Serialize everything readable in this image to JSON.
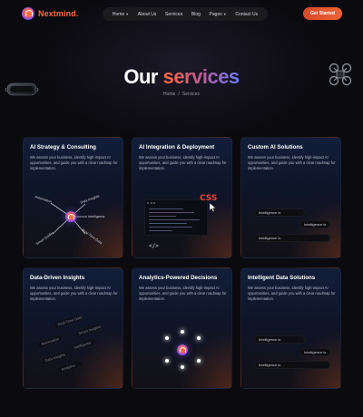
{
  "brand": {
    "name": "Nextmind",
    "dot": "."
  },
  "nav": {
    "items": [
      {
        "label": "Home",
        "dropdown": true
      },
      {
        "label": "About Us",
        "dropdown": false
      },
      {
        "label": "Services",
        "dropdown": false
      },
      {
        "label": "Blog",
        "dropdown": false
      },
      {
        "label": "Pages",
        "dropdown": true
      },
      {
        "label": "Contact Us",
        "dropdown": false
      }
    ],
    "cta_label": "Get Started"
  },
  "hero": {
    "title_part1": "Our",
    "title_part2": "services",
    "breadcrumb": {
      "home": "Home",
      "separator": "/",
      "current": "Services"
    }
  },
  "cards": [
    {
      "title": "AI Strategy & Consulting",
      "description": "We assess your business, identify high-impact AI opportunities, and guide you with a clear roadmap for implementation.",
      "art_labels": [
        "Automation",
        "Data Insights",
        "Intelligenta",
        "Smart Guides",
        "Real-Time Data"
      ]
    },
    {
      "title": "AI Integration & Deployment",
      "description": "We assess your business, identify high-impact AI opportunities, and guide you with a clear roadmap for implementation.",
      "art_labels": [
        "CSS",
        "</>"
      ]
    },
    {
      "title": "Custom AI Solutions",
      "description": "We assess your business, identify high-impact AI opportunities, and guide you with a clear roadmap for implementation.",
      "art_labels": [
        "Intelligence is",
        "Intelligence is",
        "Intelligence is"
      ]
    },
    {
      "title": "Data-Driven Insights",
      "description": "We assess your business, identify high-impact AI opportunities, and guide you with a clear roadmap for implementation.",
      "art_labels": [
        "Real-Time Data",
        "Smart Insights",
        "Automation",
        "Intelligenta",
        "Data Insights",
        "Analytics"
      ]
    },
    {
      "title": "Analytics-Powered Decisions",
      "description": "We assess your business, identify high-impact AI opportunities, and guide you with a clear roadmap for implementation.",
      "art_labels": []
    },
    {
      "title": "Intelligent Data Solutions",
      "description": "We assess your business, identify high-impact AI opportunities, and guide you with a clear roadmap for implementation.",
      "art_labels": [
        "Intelligence is",
        "Intelligence is",
        "Intelligence is"
      ]
    }
  ],
  "colors": {
    "accent": "#ee6236",
    "accent_blue": "#6a7cff",
    "background": "#0b0b0f"
  }
}
